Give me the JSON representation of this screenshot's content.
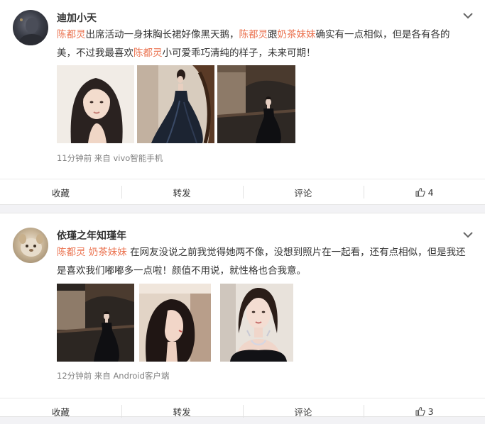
{
  "posts": [
    {
      "username": "迪加小天",
      "content": [
        {
          "text": "陈都灵",
          "hl": true
        },
        {
          "text": "出席活动一身抹胸长裙好像黑天鹅，",
          "hl": false
        },
        {
          "text": "陈都灵",
          "hl": true
        },
        {
          "text": "跟",
          "hl": false
        },
        {
          "text": "奶茶妹妹",
          "hl": true
        },
        {
          "text": "确实有一点相似，但是各有各的美，不过我最喜欢",
          "hl": false
        },
        {
          "text": "陈都灵",
          "hl": true
        },
        {
          "text": "小可爱乖巧清纯的样子，未来可期！",
          "hl": false
        }
      ],
      "meta": "11分钟前 来自 vivo智能手机",
      "actions": {
        "favorite": "收藏",
        "repost": "转发",
        "comment": "评论",
        "likes": "4"
      }
    },
    {
      "username": "依瑾之年知瑾年",
      "content": [
        {
          "text": "陈都灵",
          "hl": true
        },
        {
          "text": " ",
          "hl": false
        },
        {
          "text": "奶茶妹妹",
          "hl": true
        },
        {
          "text": " 在网友没说之前我觉得她两不像，没想到照片在一起看，还有点相似，但是我还是喜欢我们嘟嘟多一点啦！颜值不用说，就性格也合我意。",
          "hl": false
        }
      ],
      "meta": "12分钟前 来自 Android客户端",
      "actions": {
        "favorite": "收藏",
        "repost": "转发",
        "comment": "评论",
        "likes": "3"
      }
    }
  ],
  "colors": {
    "highlight": "#eb7350",
    "text": "#333333",
    "meta": "#808080",
    "background": "#f2f2f5"
  },
  "icons": [
    "chevron-down-icon",
    "thumbs-up-icon"
  ]
}
